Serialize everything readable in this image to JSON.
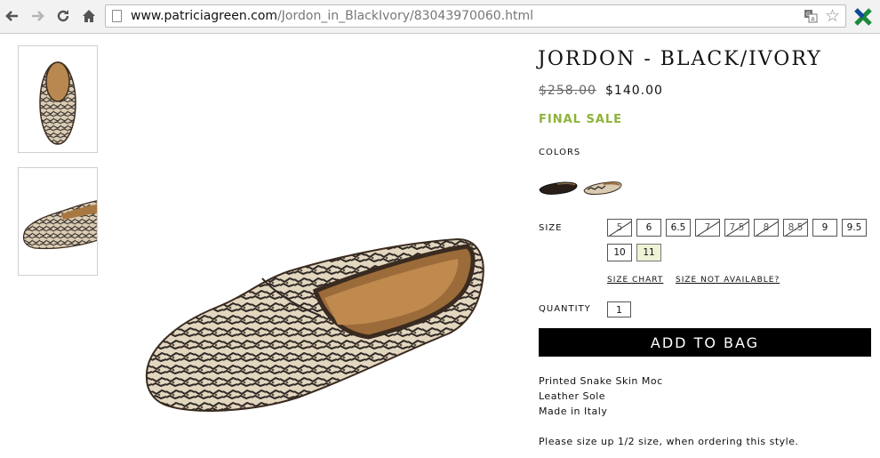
{
  "browser": {
    "url_host": "www.patriciagreen.com",
    "url_path": "/Jordon_in_BlackIvory/83043970060.html"
  },
  "product": {
    "title": "JORDON - BLACK/IVORY",
    "price_original": "$258.00",
    "price_sale": "$140.00",
    "final_sale": "FINAL SALE",
    "colors_label": "COLORS",
    "size_label": "SIZE",
    "sizes": [
      {
        "label": "5",
        "available": false
      },
      {
        "label": "6",
        "available": true
      },
      {
        "label": "6.5",
        "available": true
      },
      {
        "label": "7",
        "available": false
      },
      {
        "label": "7.5",
        "available": false
      },
      {
        "label": "8",
        "available": false
      },
      {
        "label": "8.5",
        "available": false
      },
      {
        "label": "9",
        "available": true
      },
      {
        "label": "9.5",
        "available": true
      },
      {
        "label": "10",
        "available": true
      },
      {
        "label": "11",
        "available": true,
        "selected": true
      }
    ],
    "size_chart_link": "SIZE CHART",
    "size_not_available_link": "SIZE NOT AVAILABLE?",
    "quantity_label": "QUANTITY",
    "quantity_value": "1",
    "add_to_bag": "ADD TO BAG",
    "description": [
      "Printed Snake Skin Moc",
      "Leather Sole",
      "Made in Italy"
    ],
    "note": "Please size up 1/2 size, when ordering this style."
  },
  "colors": {
    "sale_green": "#8db33a",
    "button_black": "#000000",
    "selected_size_bg": "#eef3d6"
  },
  "icons": [
    "back-arrow-icon",
    "forward-arrow-icon",
    "reload-icon",
    "home-icon",
    "page-icon",
    "translate-icon",
    "star-icon",
    "extension-icon"
  ]
}
